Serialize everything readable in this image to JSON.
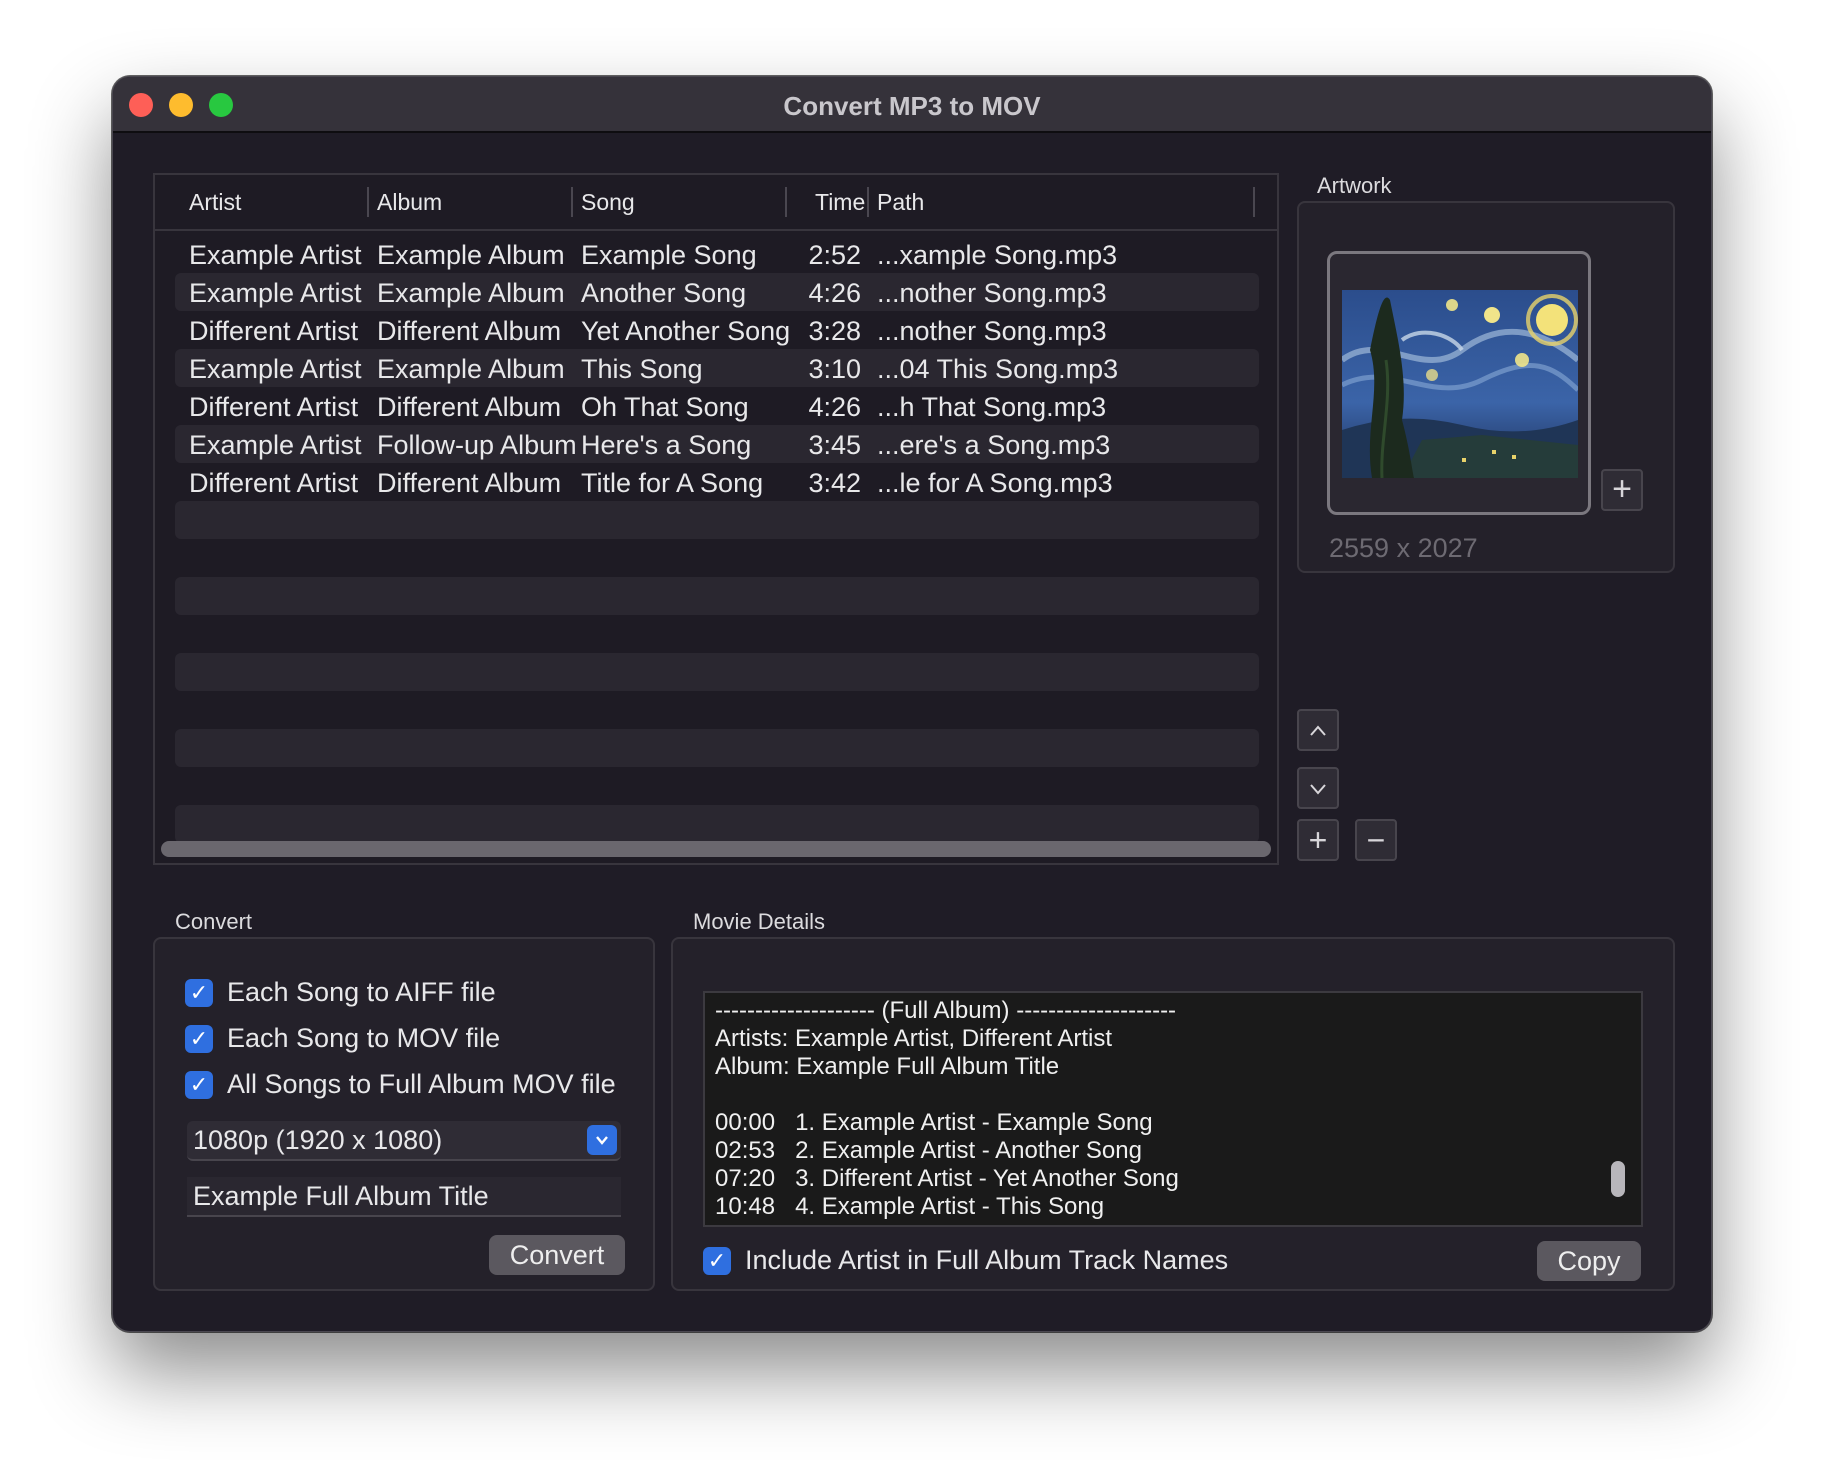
{
  "window": {
    "title": "Convert MP3 to MOV"
  },
  "table": {
    "columns": [
      "Artist",
      "Album",
      "Song",
      "Time",
      "Path"
    ],
    "rows": [
      {
        "artist": "Example Artist",
        "album": "Example Album",
        "song": "Example Song",
        "time": "2:52",
        "path": "...xample Song.mp3"
      },
      {
        "artist": "Example Artist",
        "album": "Example Album",
        "song": "Another Song",
        "time": "4:26",
        "path": "...nother Song.mp3"
      },
      {
        "artist": "Different Artist",
        "album": "Different Album",
        "song": "Yet Another Song",
        "time": "3:28",
        "path": "...nother Song.mp3"
      },
      {
        "artist": "Example Artist",
        "album": "Example Album",
        "song": "This Song",
        "time": "3:10",
        "path": "...04 This Song.mp3"
      },
      {
        "artist": "Different Artist",
        "album": "Different Album",
        "song": "Oh That Song",
        "time": "4:26",
        "path": "...h That Song.mp3"
      },
      {
        "artist": "Example Artist",
        "album": "Follow-up Album",
        "song": "Here's a Song",
        "time": "3:45",
        "path": "...ere's a Song.mp3"
      },
      {
        "artist": "Different Artist",
        "album": "Different Album",
        "song": "Title for A Song",
        "time": "3:42",
        "path": "...le for A Song.mp3"
      }
    ]
  },
  "artwork": {
    "label": "Artwork",
    "dimensions": "2559 x 2027",
    "add_icon": "plus-icon"
  },
  "list_controls": {
    "move_up_icon": "chevron-up-icon",
    "move_down_icon": "chevron-down-icon",
    "add_icon": "plus-icon",
    "remove_icon": "minus-icon"
  },
  "convert": {
    "label": "Convert",
    "options": [
      {
        "label": "Each Song to AIFF file",
        "checked": true
      },
      {
        "label": "Each Song to MOV file",
        "checked": true
      },
      {
        "label": "All Songs to Full Album MOV file",
        "checked": true
      }
    ],
    "resolution": "1080p (1920 x 1080)",
    "album_title": "Example Full Album Title",
    "button": "Convert"
  },
  "details": {
    "label": "Movie Details",
    "lines": [
      "-------------------- (Full Album) --------------------",
      "Artists: Example Artist, Different Artist",
      "Album: Example Full Album Title",
      "",
      "00:00   1. Example Artist - Example Song",
      "02:53   2. Example Artist - Another Song",
      "07:20   3. Different Artist - Yet Another Song",
      "10:48   4. Example Artist - This Song"
    ],
    "include_artist": {
      "label": "Include Artist in Full Album Track Names",
      "checked": true
    },
    "copy_button": "Copy"
  },
  "colors": {
    "accent": "#2f6fe0",
    "window_bg": "#1f1c26",
    "row_alt": "#2a2730"
  }
}
